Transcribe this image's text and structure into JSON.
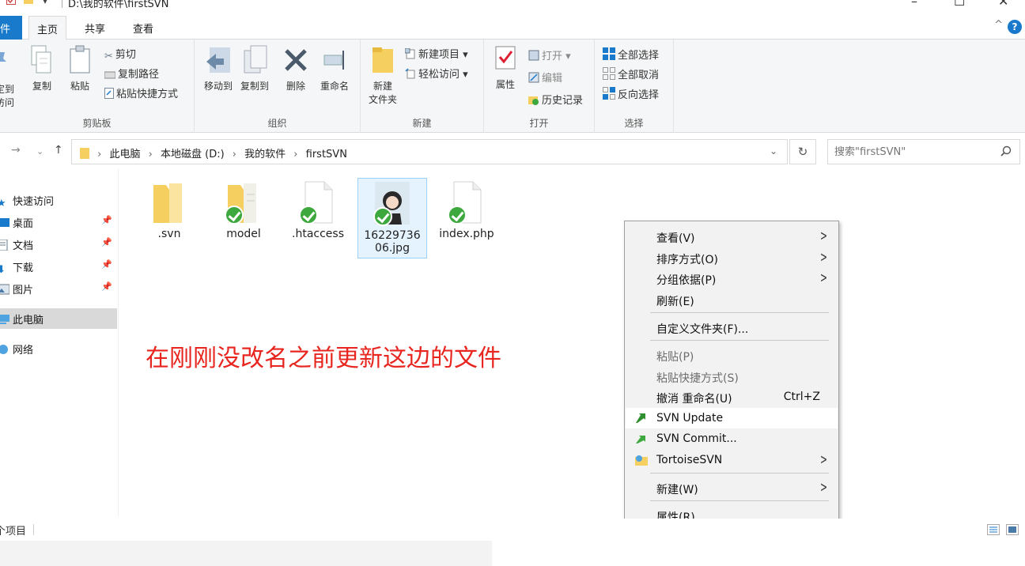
{
  "window": {
    "path": "D:\\我的软件\\firstSVN",
    "controls": [
      "–",
      "☐",
      "✕"
    ]
  },
  "tabs": {
    "file": "件",
    "home": "主页",
    "share": "共享",
    "view": "查看",
    "help": "?",
    "collapse": "^"
  },
  "ribbon": {
    "clipboard": {
      "pin_line1": "定到",
      "pin_line2": "访问",
      "copy": "复制",
      "paste": "粘贴",
      "cut": "剪切",
      "copy_path": "复制路径",
      "paste_shortcut": "粘贴快捷方式",
      "label": "剪贴板"
    },
    "organize": {
      "move_to": "移动到",
      "copy_to": "复制到",
      "delete": "删除",
      "rename": "重命名",
      "label": "组织"
    },
    "new": {
      "new_folder_line1": "新建",
      "new_folder_line2": "文件夹",
      "new_item": "新建项目 ▾",
      "easy_access": "轻松访问 ▾",
      "label": "新建"
    },
    "open": {
      "properties": "属性",
      "open": "打开 ▾",
      "edit": "编辑",
      "history": "历史记录",
      "label": "打开"
    },
    "select": {
      "select_all": "全部选择",
      "select_none": "全部取消",
      "invert": "反向选择",
      "label": "选择"
    }
  },
  "address": {
    "crumbs": [
      "此电脑",
      "本地磁盘 (D:)",
      "我的软件",
      "firstSVN"
    ],
    "search_placeholder": "搜索\"firstSVN\""
  },
  "sidebar": {
    "items": [
      {
        "label": "快速访问"
      },
      {
        "label": "桌面",
        "pinned": true
      },
      {
        "label": "文档",
        "pinned": true
      },
      {
        "label": "下载",
        "pinned": true
      },
      {
        "label": "图片",
        "pinned": true
      },
      {
        "label": "此电脑",
        "selected": true
      },
      {
        "label": "网络"
      }
    ]
  },
  "files": [
    {
      "name": ".svn",
      "type": "folder",
      "svn_ok": false
    },
    {
      "name": "model",
      "type": "folder",
      "svn_ok": true
    },
    {
      "name": ".htaccess",
      "type": "file",
      "svn_ok": true
    },
    {
      "name_line1": "16229736",
      "name_line2": "06.jpg",
      "type": "image",
      "svn_ok": true,
      "selected": true
    },
    {
      "name": "index.php",
      "type": "file",
      "svn_ok": true
    }
  ],
  "annotation": "在刚刚没改名之前更新这边的文件",
  "context_menu": {
    "items": [
      {
        "label": "查看(V)",
        "submenu": true
      },
      {
        "label": "排序方式(O)",
        "submenu": true
      },
      {
        "label": "分组依据(P)",
        "submenu": true
      },
      {
        "label": "刷新(E)"
      },
      {
        "label": "自定义文件夹(F)..."
      },
      {
        "label": "粘贴(P)",
        "disabled": true
      },
      {
        "label": "粘贴快捷方式(S)",
        "disabled": true
      },
      {
        "label": "撤消 重命名(U)",
        "shortcut": "Ctrl+Z"
      },
      {
        "label": "SVN Update",
        "highlighted": true
      },
      {
        "label": "SVN Commit..."
      },
      {
        "label": "TortoiseSVN",
        "submenu": true
      },
      {
        "label": "新建(W)",
        "submenu": true
      },
      {
        "label": "属性(R)"
      }
    ],
    "arrow": ">"
  },
  "status": {
    "items_text": "个项目"
  },
  "colors": {
    "accent": "#1979ca",
    "annotation": "#e8251f",
    "svn_ok": "#3da83d",
    "folder": "#f5cf60"
  }
}
